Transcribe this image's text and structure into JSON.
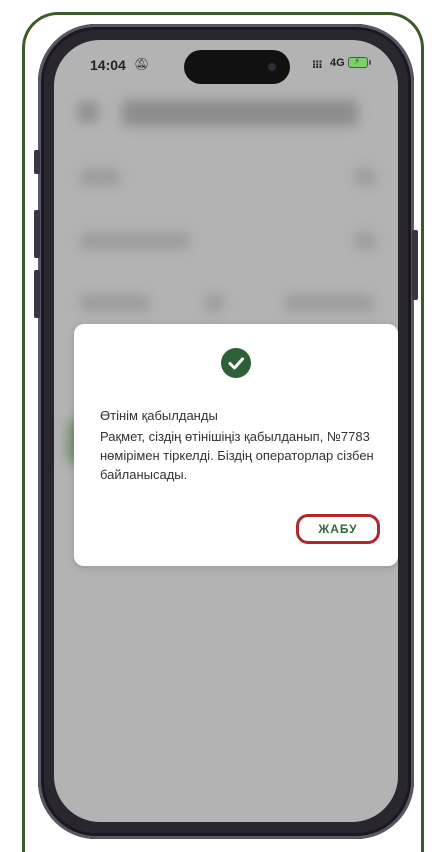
{
  "status_bar": {
    "time": "14:04",
    "network": "4G"
  },
  "dialog": {
    "title": "Өтінім қабылданды",
    "message": "Рақмет, сіздің өтінішіңіз қабылданып, №7783 нөмірімен тіркелді. Біздің операторлар сізбен байланысады.",
    "close_label": "ЖАБУ"
  },
  "colors": {
    "accent_green": "#2f5f39",
    "highlight_red": "#b3262c"
  },
  "icons": [
    "mute-bell-icon",
    "signal-icon",
    "battery-charging-icon",
    "check-circle-icon"
  ]
}
